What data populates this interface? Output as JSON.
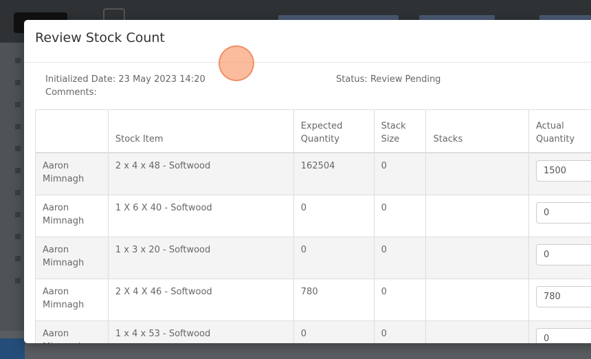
{
  "modal": {
    "title": "Review Stock Count",
    "initialized_label": "Initialized Date:",
    "initialized_value": "23 May 2023 14:20",
    "comments_label": "Comments:",
    "status_label": "Status:",
    "status_value": "Review Pending"
  },
  "table": {
    "headers": [
      "",
      "Stock Item",
      "Expected Quantity",
      "Stack Size",
      "Stacks",
      "Actual Quantity"
    ],
    "rows": [
      {
        "user": "Aaron Mimnagh",
        "item": "2 x 4 x 48 - Softwood",
        "expected": "162504",
        "stack_size": "0",
        "stacks": "",
        "actual": "1500"
      },
      {
        "user": "Aaron Mimnagh",
        "item": "1 X 6 X 40 - Softwood",
        "expected": "0",
        "stack_size": "0",
        "stacks": "",
        "actual": "0"
      },
      {
        "user": "Aaron Mimnagh",
        "item": "1 x 3 x 20 - Softwood",
        "expected": "0",
        "stack_size": "0",
        "stacks": "",
        "actual": "0"
      },
      {
        "user": "Aaron Mimnagh",
        "item": "2 X 4 X 46 - Softwood",
        "expected": "780",
        "stack_size": "0",
        "stacks": "",
        "actual": "780"
      },
      {
        "user": "Aaron Mimnagh",
        "item": "1 x 4 x 53 - Softwood",
        "expected": "0",
        "stack_size": "0",
        "stacks": "",
        "actual": "0"
      }
    ]
  }
}
